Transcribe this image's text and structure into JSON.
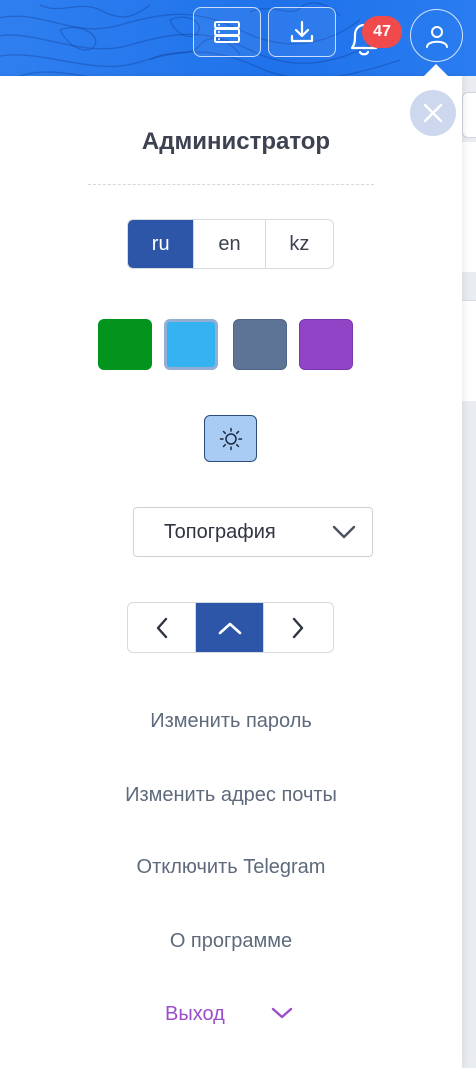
{
  "header": {
    "notifications_count": "47",
    "icons": [
      "layers-icon",
      "download-icon",
      "bell-icon",
      "user-icon"
    ],
    "colors": {
      "bar": "#1f72ea",
      "badge": "#f04a4c"
    }
  },
  "panel": {
    "title": "Администратор",
    "languages": [
      {
        "label": "ru",
        "active": true
      },
      {
        "label": "en",
        "active": false
      },
      {
        "label": "kz",
        "active": false
      }
    ],
    "color_swatches": [
      {
        "name": "green",
        "color": "#03941e",
        "selected": false
      },
      {
        "name": "light-blue",
        "color": "#35b3f1",
        "selected": true
      },
      {
        "name": "slate",
        "color": "#5e7497",
        "selected": false
      },
      {
        "name": "purple",
        "color": "#9145c6",
        "selected": false
      }
    ],
    "theme_icon": "sun-icon",
    "map_style": {
      "selected": "Топография"
    },
    "position_controls": [
      "left",
      "up",
      "right"
    ],
    "active_position": "up",
    "menu": {
      "change_password": "Изменить пароль",
      "change_email": "Изменить адрес почты",
      "disconnect_telegram": "Отключить Telegram",
      "about": "О программе",
      "logout": "Выход"
    },
    "accent_color": "#2d56a8",
    "logout_color": "#9b4ecb"
  }
}
